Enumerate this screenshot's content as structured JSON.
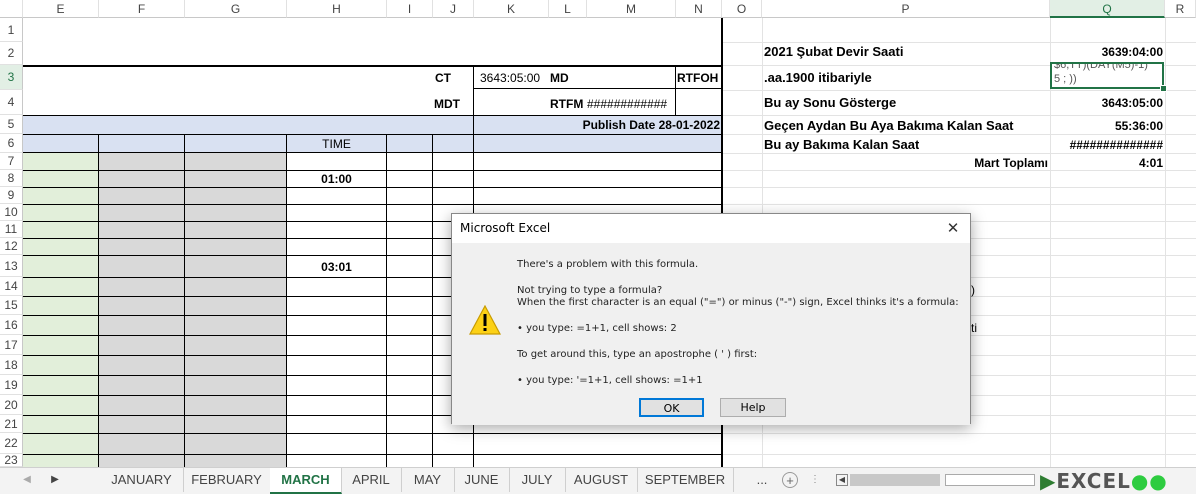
{
  "columns": {
    "E": "E",
    "F": "F",
    "G": "G",
    "H": "H",
    "I": "I",
    "J": "J",
    "K": "K",
    "L": "L",
    "M": "M",
    "N": "N",
    "O": "O",
    "P": "P",
    "Q": "Q",
    "R": "R"
  },
  "rows": [
    "1",
    "2",
    "3",
    "4",
    "5",
    "6",
    "7",
    "8",
    "9",
    "10",
    "11",
    "12",
    "13",
    "14",
    "15",
    "16",
    "17",
    "18",
    "19",
    "20",
    "21",
    "22",
    "23"
  ],
  "sheet": {
    "ct_label": "CT",
    "ct_value": "3643:05:00",
    "md_label": "MD",
    "rtfoh_label": "RTFOH",
    "mdt_label": "MDT",
    "rtfm_label": "RTFM",
    "rtfm_value": "############",
    "publish_date": "Publish Date 28-01-2022",
    "time_header": "TIME",
    "time_row8": "01:00",
    "time_row13": "03:01"
  },
  "summary": {
    "p2_label": "2021 Şubat Devir Saati",
    "q2_value": "3639:04:00",
    "p3_label": ".aa.1900 itibariyle",
    "q3_value_line1": "$6,TT)(DAY(M5)-1)",
    "q3_value_line2": "5 ; ))",
    "p4_label": "Bu ay Sonu Gösterge",
    "q4_value": "3643:05:00",
    "p5_label": "Geçen Aydan Bu Aya Bakıma Kalan Saat",
    "q5_value": "55:36:00",
    "p6_label": "Bu ay Bakıma Kalan Saat",
    "q6_value": "##############",
    "p7_label": "Mart Toplamı",
    "q7_value": "4:01",
    "p14_partial": ")",
    "p16_partial": "ti"
  },
  "tabs": [
    "JANUARY",
    "FEBRUARY",
    "MARCH",
    "APRIL",
    "MAY",
    "JUNE",
    "JULY",
    "AUGUST",
    "SEPTEMBER"
  ],
  "tabs_more": "...",
  "tabs_add": "+",
  "logo_text": "EXCEL",
  "dialog": {
    "title": "Microsoft Excel",
    "close": "✕",
    "line1": "There's a problem with this formula.",
    "line2": "Not trying to type a formula?",
    "line3": "When the first character is an equal (\"=\") or minus (\"-\") sign, Excel thinks it's a formula:",
    "line4": "• you type:   =1+1, cell shows:   2",
    "line5": "To get around this, type an apostrophe ( ' ) first:",
    "line6": "• you type:   '=1+1, cell shows:   =1+1",
    "ok_label": "OK",
    "help_label": "Help"
  },
  "colors": {
    "excel_green": "#217346",
    "header_blue": "#d9e1f2",
    "gray_fill": "#d9d9d9",
    "green_fill": "#e2efda"
  }
}
